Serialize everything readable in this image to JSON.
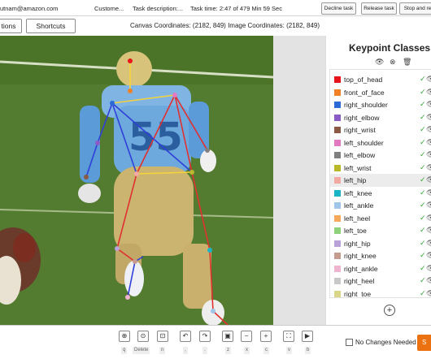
{
  "topbar": {
    "email": "utnam@amazon.com",
    "customer": "Custome...",
    "task_description": "Task description:...",
    "task_time": "Task time: 2:47 of 479 Min 59 Sec",
    "decline": "Decline task",
    "release": "Release task",
    "stop": "Stop and re"
  },
  "toolbar": {
    "instructions": "tions",
    "shortcuts": "Shortcuts",
    "coords": "Canvas Coordinates: (2182, 849) Image Coordinates: (2182, 849)"
  },
  "panel": {
    "title": "Keypoint Classes",
    "items": [
      {
        "label": "top_of_head",
        "color": "#e8141b"
      },
      {
        "label": "front_of_face",
        "color": "#f08125"
      },
      {
        "label": "right_shoulder",
        "color": "#2c6bd6"
      },
      {
        "label": "right_elbow",
        "color": "#8a5bc7"
      },
      {
        "label": "right_wrist",
        "color": "#8a5a44"
      },
      {
        "label": "left_shoulder",
        "color": "#e27ac1"
      },
      {
        "label": "left_elbow",
        "color": "#808080"
      },
      {
        "label": "left_wrist",
        "color": "#b9b82a"
      },
      {
        "label": "left_hip",
        "color": "#f2a9a1"
      },
      {
        "label": "left_knee",
        "color": "#19b5c7"
      },
      {
        "label": "left_ankle",
        "color": "#9ec5ea"
      },
      {
        "label": "left_heel",
        "color": "#f6a95c"
      },
      {
        "label": "left_toe",
        "color": "#8fd27b"
      },
      {
        "label": "right_hip",
        "color": "#b9a2d8"
      },
      {
        "label": "right_knee",
        "color": "#c59a8f"
      },
      {
        "label": "right_ankle",
        "color": "#f0b3d0"
      },
      {
        "label": "right_heel",
        "color": "#c8c8c8"
      },
      {
        "label": "right_toe",
        "color": "#d9d68a"
      }
    ]
  },
  "bottom": {
    "keys": [
      "q",
      "Delete",
      "n",
      ",",
      ".",
      "z",
      "x",
      "c",
      "v",
      "b"
    ],
    "no_changes": "No Changes Needed",
    "submit": "S"
  }
}
